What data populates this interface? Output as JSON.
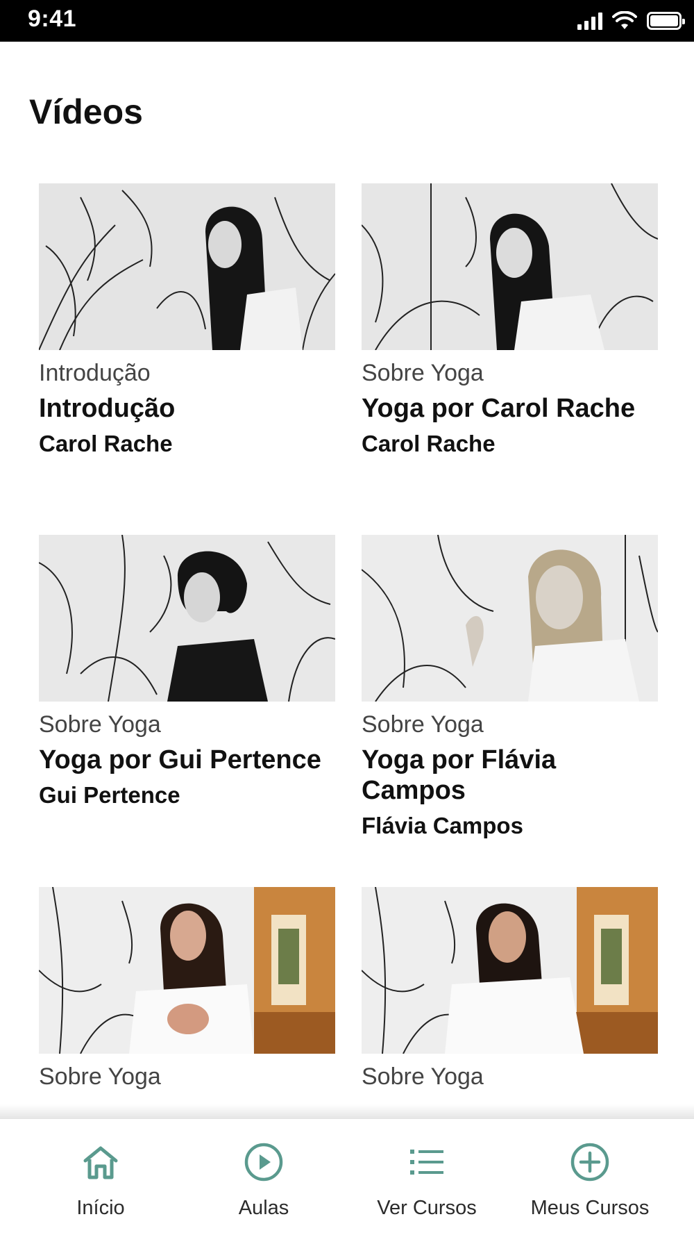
{
  "status_bar": {
    "time": "9:41"
  },
  "page": {
    "title": "Vídeos"
  },
  "videos": [
    {
      "category": "Introdução",
      "title": "Introdução",
      "author": "Carol Rache"
    },
    {
      "category": "Sobre Yoga",
      "title": "Yoga por Carol Rache",
      "author": "Carol Rache"
    },
    {
      "category": "Sobre Yoga",
      "title": "Yoga por Gui Pertence",
      "author": "Gui Pertence"
    },
    {
      "category": "Sobre Yoga",
      "title": "Yoga por Flávia Campos",
      "author": "Flávia Campos"
    },
    {
      "category": "Sobre Yoga"
    },
    {
      "category": "Sobre Yoga"
    }
  ],
  "bottom_nav": {
    "items": [
      {
        "label": "Início",
        "icon": "home-icon"
      },
      {
        "label": "Aulas",
        "icon": "play-circle-icon"
      },
      {
        "label": "Ver Cursos",
        "icon": "list-icon"
      },
      {
        "label": "Meus Cursos",
        "icon": "plus-circle-icon"
      }
    ],
    "accent_color": "#5a9a8e"
  }
}
